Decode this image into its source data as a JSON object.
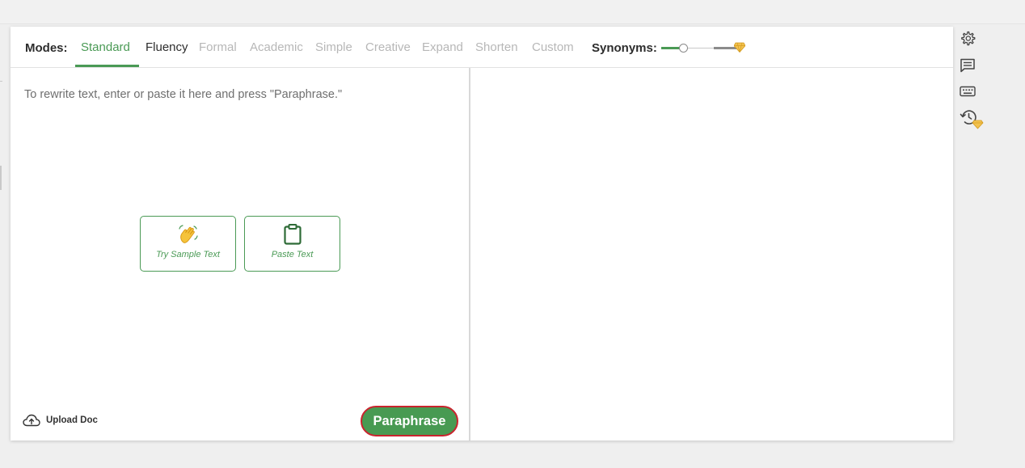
{
  "modes": {
    "label": "Modes:",
    "items": [
      {
        "label": "Standard",
        "state": "active"
      },
      {
        "label": "Fluency",
        "state": "enabled"
      },
      {
        "label": "Formal",
        "state": "disabled"
      },
      {
        "label": "Academic",
        "state": "disabled"
      },
      {
        "label": "Simple",
        "state": "disabled"
      },
      {
        "label": "Creative",
        "state": "disabled"
      },
      {
        "label": "Expand",
        "state": "disabled"
      },
      {
        "label": "Shorten",
        "state": "disabled"
      },
      {
        "label": "Custom",
        "state": "disabled"
      }
    ]
  },
  "synonyms": {
    "label": "Synonyms:",
    "level_fraction": 0.27
  },
  "editor": {
    "placeholder": "To rewrite text, enter or paste it here and press \"Paraphrase.\"",
    "try_sample_label": "Try Sample Text",
    "paste_label": "Paste Text",
    "upload_label": "Upload Doc",
    "paraphrase_label": "Paraphrase"
  },
  "side_icons": [
    "gear-icon",
    "comment-icon",
    "keyboard-icon",
    "history-icon"
  ],
  "colors": {
    "accent": "#4a9a55",
    "premium_gem": "#f2c14e",
    "highlight_ring": "#c9242e"
  }
}
